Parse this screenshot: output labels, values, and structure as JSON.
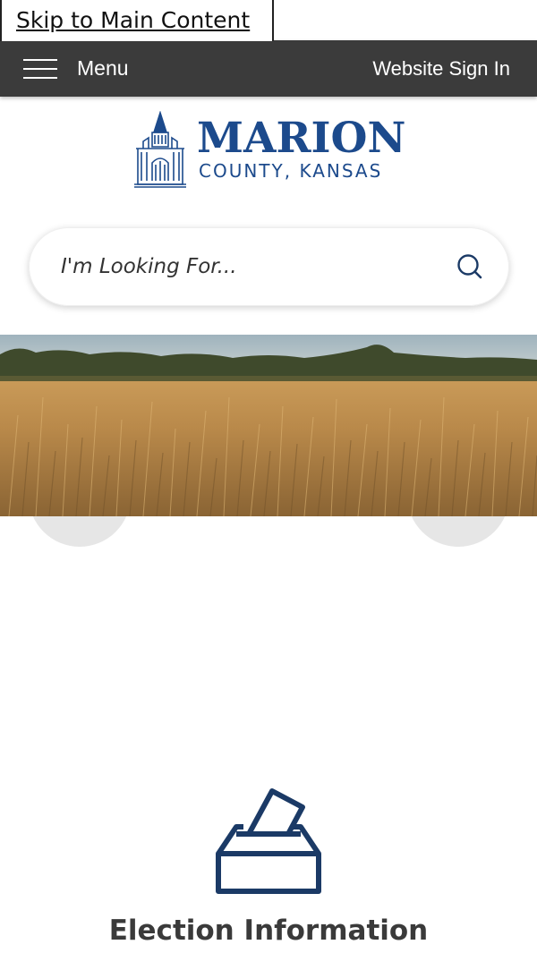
{
  "skip_link": {
    "label": "Skip to Main Content"
  },
  "topbar": {
    "menu_label": "Menu",
    "menu_icon": "hamburger-icon",
    "signin_label": "Website Sign In",
    "background": "#3b3b3b"
  },
  "logo": {
    "name": "MARION",
    "subtitle": "COUNTY, KANSAS",
    "icon": "courthouse-icon",
    "color": "#1c4a8c"
  },
  "search": {
    "placeholder": "I'm Looking For...",
    "value": "",
    "icon": "search-icon"
  },
  "hero": {
    "icon": "wheat-field-image"
  },
  "carousel": {
    "prev_icon": "chevron-left-icon",
    "next_icon": "chevron-right-icon"
  },
  "quick_links": [
    {
      "label": "Election Information",
      "icon": "ballot-box-icon",
      "color": "#1b3a66"
    }
  ]
}
